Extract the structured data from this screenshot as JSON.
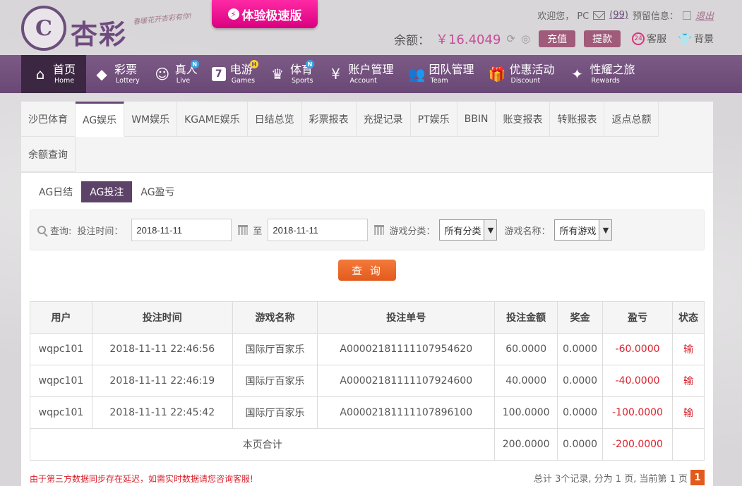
{
  "header": {
    "logo_mark": "C",
    "logo_text": "杏彩",
    "logo_slogan": "春暖花开杏彩有你!",
    "speed_banner": "体验极速版",
    "welcome": "欢迎您， PC",
    "message_count": "(99)",
    "notice_label": "预留信息：",
    "logout": "退出",
    "balance_label": "余额：",
    "balance_amount": "￥16.4049",
    "recharge": "充值",
    "withdraw": "提款",
    "service": "客服",
    "service_icon_text": "24",
    "background": "背景"
  },
  "nav": [
    {
      "zh": "首页",
      "en": "Home",
      "icon": "⌂"
    },
    {
      "zh": "彩票",
      "en": "Lottery",
      "icon": "◆"
    },
    {
      "zh": "真人",
      "en": "Live",
      "icon": "☺",
      "badge": "N"
    },
    {
      "zh": "电游",
      "en": "Games",
      "icon": "7",
      "badge": "H"
    },
    {
      "zh": "体育",
      "en": "Sports",
      "icon": "♛",
      "badge": "N"
    },
    {
      "zh": "账户管理",
      "en": "Account",
      "icon": "¥"
    },
    {
      "zh": "团队管理",
      "en": "Team",
      "icon": "👥"
    },
    {
      "zh": "优惠活动",
      "en": "Discount",
      "icon": "🎁"
    },
    {
      "zh": "性耀之旅",
      "en": "Rewards",
      "icon": "✦"
    }
  ],
  "tabs": [
    "沙巴体育",
    "AG娱乐",
    "WM娱乐",
    "KGAME娱乐",
    "日结总览",
    "彩票报表",
    "充提记录",
    "PT娱乐",
    "BBIN",
    "账变报表",
    "转账报表",
    "返点总额",
    "余额查询"
  ],
  "subtabs": [
    "AG日结",
    "AG投注",
    "AG盈亏"
  ],
  "filter": {
    "query_label": "查询:",
    "time_label": "投注时间：",
    "start_date": "2018-11-11",
    "to": "至",
    "end_date": "2018-11-11",
    "category_label": "游戏分类：",
    "category_value": "所有分类",
    "name_label": "游戏名称：",
    "name_value": "所有游戏",
    "query_button": "查 询"
  },
  "table": {
    "headers": [
      "用户",
      "投注时间",
      "游戏名称",
      "投注单号",
      "投注金额",
      "奖金",
      "盈亏",
      "状态"
    ],
    "rows": [
      [
        "wqpc101",
        "2018-11-11 22:46:56",
        "国际厅百家乐",
        "A00002181111107954620",
        "60.0000",
        "0.0000",
        "-60.0000",
        "输"
      ],
      [
        "wqpc101",
        "2018-11-11 22:46:19",
        "国际厅百家乐",
        "A00002181111107924600",
        "40.0000",
        "0.0000",
        "-40.0000",
        "输"
      ],
      [
        "wqpc101",
        "2018-11-11 22:45:42",
        "国际厅百家乐",
        "A00002181111107896100",
        "100.0000",
        "0.0000",
        "-100.0000",
        "输"
      ]
    ],
    "total": {
      "label": "本页合计",
      "amount": "200.0000",
      "bonus": "0.0000",
      "profit": "-200.0000"
    }
  },
  "footer": {
    "note": "由于第三方数据同步存在延迟，如需实时数据请您咨询客服!",
    "pager_text": "总计 3个记录, 分为 1 页, 当前第 1 页",
    "current_page": "1"
  }
}
